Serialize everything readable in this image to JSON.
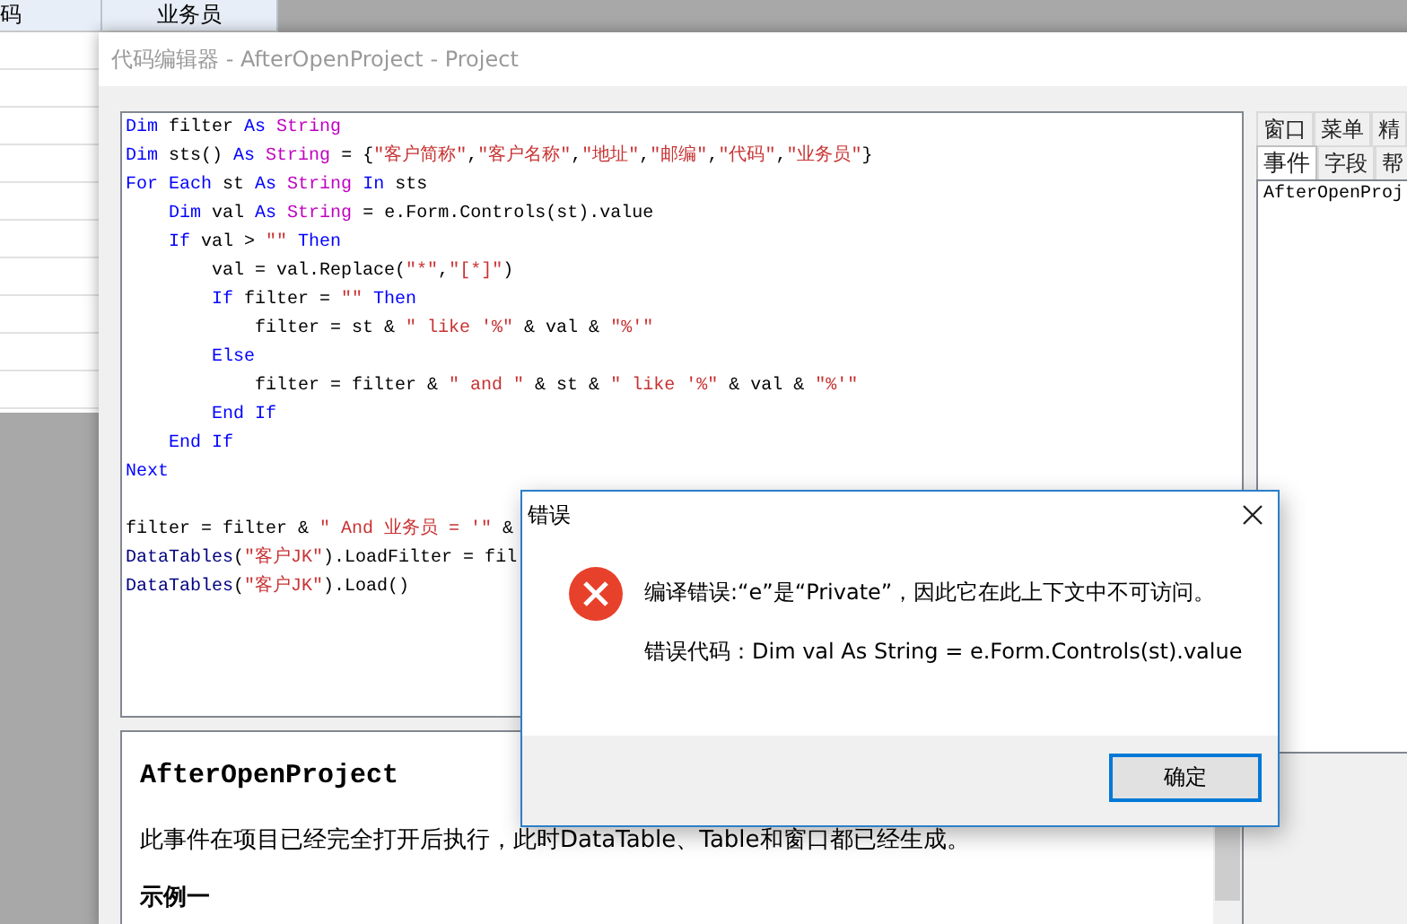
{
  "background_table": {
    "columns": [
      "码",
      "业务员"
    ]
  },
  "editor": {
    "title": "代码编辑器 - AfterOpenProject - Project",
    "code_lines": [
      {
        "tokens": [
          {
            "kind": "keyword",
            "text": "Dim"
          },
          {
            "kind": "plain",
            "text": " filter "
          },
          {
            "kind": "keyword",
            "text": "As"
          },
          {
            "kind": "type",
            "text": " String"
          }
        ]
      },
      {
        "tokens": [
          {
            "kind": "keyword",
            "text": "Dim"
          },
          {
            "kind": "plain",
            "text": " sts() "
          },
          {
            "kind": "keyword",
            "text": "As"
          },
          {
            "kind": "type",
            "text": " String"
          },
          {
            "kind": "plain",
            "text": " = {"
          },
          {
            "kind": "string",
            "text": "\"客户简称\""
          },
          {
            "kind": "plain",
            "text": ","
          },
          {
            "kind": "string",
            "text": "\"客户名称\""
          },
          {
            "kind": "plain",
            "text": ","
          },
          {
            "kind": "string",
            "text": "\"地址\""
          },
          {
            "kind": "plain",
            "text": ","
          },
          {
            "kind": "string",
            "text": "\"邮编\""
          },
          {
            "kind": "plain",
            "text": ","
          },
          {
            "kind": "string",
            "text": "\"代码\""
          },
          {
            "kind": "plain",
            "text": ","
          },
          {
            "kind": "string",
            "text": "\"业务员\""
          },
          {
            "kind": "plain",
            "text": "}"
          }
        ]
      },
      {
        "tokens": [
          {
            "kind": "keyword",
            "text": "For Each"
          },
          {
            "kind": "plain",
            "text": " st "
          },
          {
            "kind": "keyword",
            "text": "As"
          },
          {
            "kind": "type",
            "text": " String"
          },
          {
            "kind": "keyword",
            "text": " In"
          },
          {
            "kind": "plain",
            "text": " sts"
          }
        ]
      },
      {
        "tokens": [
          {
            "kind": "keyword",
            "text": "    Dim"
          },
          {
            "kind": "plain",
            "text": " val "
          },
          {
            "kind": "keyword",
            "text": "As"
          },
          {
            "kind": "type",
            "text": " String"
          },
          {
            "kind": "plain",
            "text": " = e.Form.Controls(st).value"
          }
        ]
      },
      {
        "tokens": [
          {
            "kind": "keyword",
            "text": "    If"
          },
          {
            "kind": "plain",
            "text": " val > "
          },
          {
            "kind": "string",
            "text": "\"\""
          },
          {
            "kind": "keyword",
            "text": " Then"
          }
        ]
      },
      {
        "tokens": [
          {
            "kind": "plain",
            "text": "        val = val.Replace("
          },
          {
            "kind": "string",
            "text": "\"*\""
          },
          {
            "kind": "plain",
            "text": ","
          },
          {
            "kind": "string",
            "text": "\"[*]\""
          },
          {
            "kind": "plain",
            "text": ")"
          }
        ]
      },
      {
        "tokens": [
          {
            "kind": "keyword",
            "text": "        If"
          },
          {
            "kind": "plain",
            "text": " filter = "
          },
          {
            "kind": "string",
            "text": "\"\""
          },
          {
            "kind": "keyword",
            "text": " Then"
          }
        ]
      },
      {
        "tokens": [
          {
            "kind": "plain",
            "text": "            filter = st & "
          },
          {
            "kind": "string",
            "text": "\" like '%\""
          },
          {
            "kind": "plain",
            "text": " & val & "
          },
          {
            "kind": "string",
            "text": "\"%'\""
          }
        ]
      },
      {
        "tokens": [
          {
            "kind": "keyword",
            "text": "        Else"
          }
        ]
      },
      {
        "tokens": [
          {
            "kind": "plain",
            "text": "            filter = filter & "
          },
          {
            "kind": "string",
            "text": "\" and \""
          },
          {
            "kind": "plain",
            "text": " & st & "
          },
          {
            "kind": "string",
            "text": "\" like '%\""
          },
          {
            "kind": "plain",
            "text": " & val & "
          },
          {
            "kind": "string",
            "text": "\"%'\""
          }
        ]
      },
      {
        "tokens": [
          {
            "kind": "keyword",
            "text": "        End If"
          }
        ]
      },
      {
        "tokens": [
          {
            "kind": "keyword",
            "text": "    End If"
          }
        ]
      },
      {
        "tokens": [
          {
            "kind": "keyword",
            "text": "Next"
          }
        ]
      },
      {
        "kind": "blank"
      },
      {
        "tokens": [
          {
            "kind": "plain",
            "text": "filter = filter & "
          },
          {
            "kind": "string",
            "text": "\" And 业务员 = '\""
          },
          {
            "kind": "plain",
            "text": " &"
          }
        ]
      },
      {
        "tokens": [
          {
            "kind": "object",
            "text": "DataTables"
          },
          {
            "kind": "plain",
            "text": "("
          },
          {
            "kind": "string",
            "text": "\"客户JK\""
          },
          {
            "kind": "plain",
            "text": ").LoadFilter = fil"
          }
        ]
      },
      {
        "tokens": [
          {
            "kind": "object",
            "text": "DataTables"
          },
          {
            "kind": "plain",
            "text": "("
          },
          {
            "kind": "string",
            "text": "\"客户JK\""
          },
          {
            "kind": "plain",
            "text": ").Load()"
          }
        ]
      }
    ],
    "side_tab_rows": [
      [
        {
          "label": "窗口",
          "selected": false
        },
        {
          "label": "菜单",
          "selected": false
        },
        {
          "label": "精",
          "selected": false
        }
      ],
      [
        {
          "label": "事件",
          "selected": true
        },
        {
          "label": "字段",
          "selected": false
        },
        {
          "label": "帮",
          "selected": false
        }
      ]
    ],
    "event_list": [
      "AfterOpenProj"
    ],
    "help": {
      "title": "AfterOpenProject",
      "text": "此事件在项目已经完全打开后执行，此时DataTable、Table和窗口都已经生成。",
      "heading": "示例一"
    }
  },
  "dialog": {
    "title": "错误",
    "message": "编译错误:“e”是“Private”，因此它在此上下文中不可访问。",
    "detail": "错误代码：Dim val As String = e.Form.Controls(st).value",
    "buttons": [
      "确定"
    ]
  }
}
